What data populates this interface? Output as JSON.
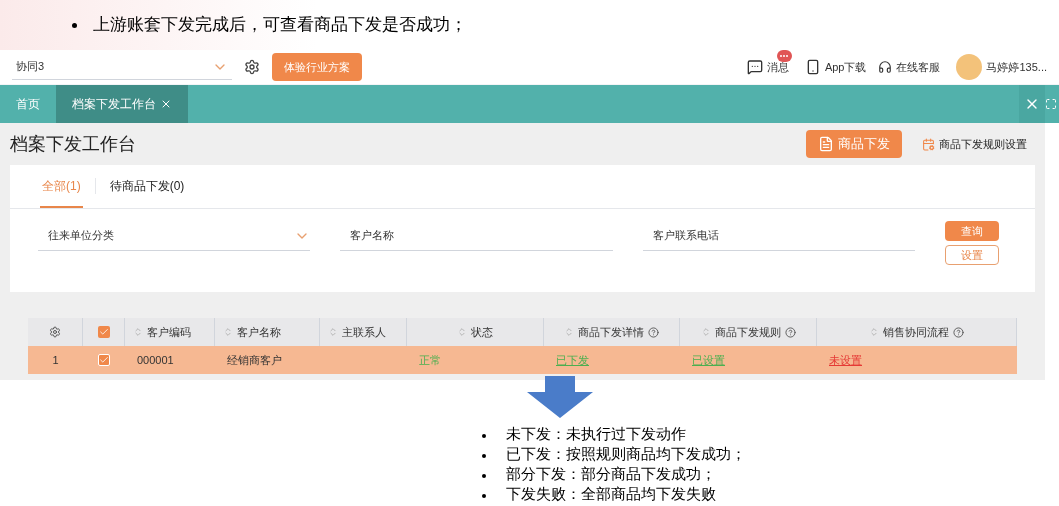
{
  "slide": {
    "bullet": "上游账套下发完成后，可查看商品下发是否成功；"
  },
  "topbar": {
    "org_select": {
      "value": "协同3"
    },
    "trial_button": "体验行业方案",
    "messages": {
      "label": "消息",
      "unread": true
    },
    "app_download": "App下载",
    "support": "在线客服",
    "user_name": "马婷婷135..."
  },
  "tabs": [
    {
      "label": "首页",
      "selected": false,
      "closable": false
    },
    {
      "label": "档案下发工作台",
      "selected": true,
      "closable": true
    }
  ],
  "page": {
    "title": "档案下发工作台",
    "primary_button": "商品下发",
    "rules_link": "商品下发规则设置",
    "subtabs": [
      {
        "label": "全部(1)",
        "selected": true
      },
      {
        "label": "待商品下发(0)",
        "selected": false
      }
    ],
    "filters": [
      {
        "label": "往来单位分类",
        "kind": "select"
      },
      {
        "label": "客户名称",
        "kind": "text"
      },
      {
        "label": "客户联系电话",
        "kind": "text"
      }
    ],
    "query_button": "查询",
    "settings_button": "设置"
  },
  "table": {
    "header_checked": true,
    "columns": [
      {
        "label": "客户编码",
        "help": false
      },
      {
        "label": "客户名称",
        "help": false
      },
      {
        "label": "主联系人",
        "help": false
      },
      {
        "label": "状态",
        "help": false
      },
      {
        "label": "商品下发详情",
        "help": true
      },
      {
        "label": "商品下发规则",
        "help": true
      },
      {
        "label": "销售协同流程",
        "help": true
      }
    ],
    "rows": [
      {
        "index": "1",
        "checked": true,
        "selected": true,
        "cells": [
          {
            "kind": "text",
            "text": "000001"
          },
          {
            "kind": "text",
            "text": "经销商客户"
          },
          {
            "kind": "empty"
          },
          {
            "kind": "status",
            "text": "正常"
          },
          {
            "kind": "link",
            "text": "已下发",
            "color": "#4caf50"
          },
          {
            "kind": "link",
            "text": "已设置",
            "color": "#4caf50"
          },
          {
            "kind": "link",
            "text": "未设置",
            "color": "#e53935"
          }
        ]
      }
    ]
  },
  "notes": [
    "未下发：未执行过下发动作",
    "已下发：按照规则商品均下发成功；",
    "部分下发：部分商品下发成功；",
    "下发失败：全部商品均下发失败"
  ]
}
